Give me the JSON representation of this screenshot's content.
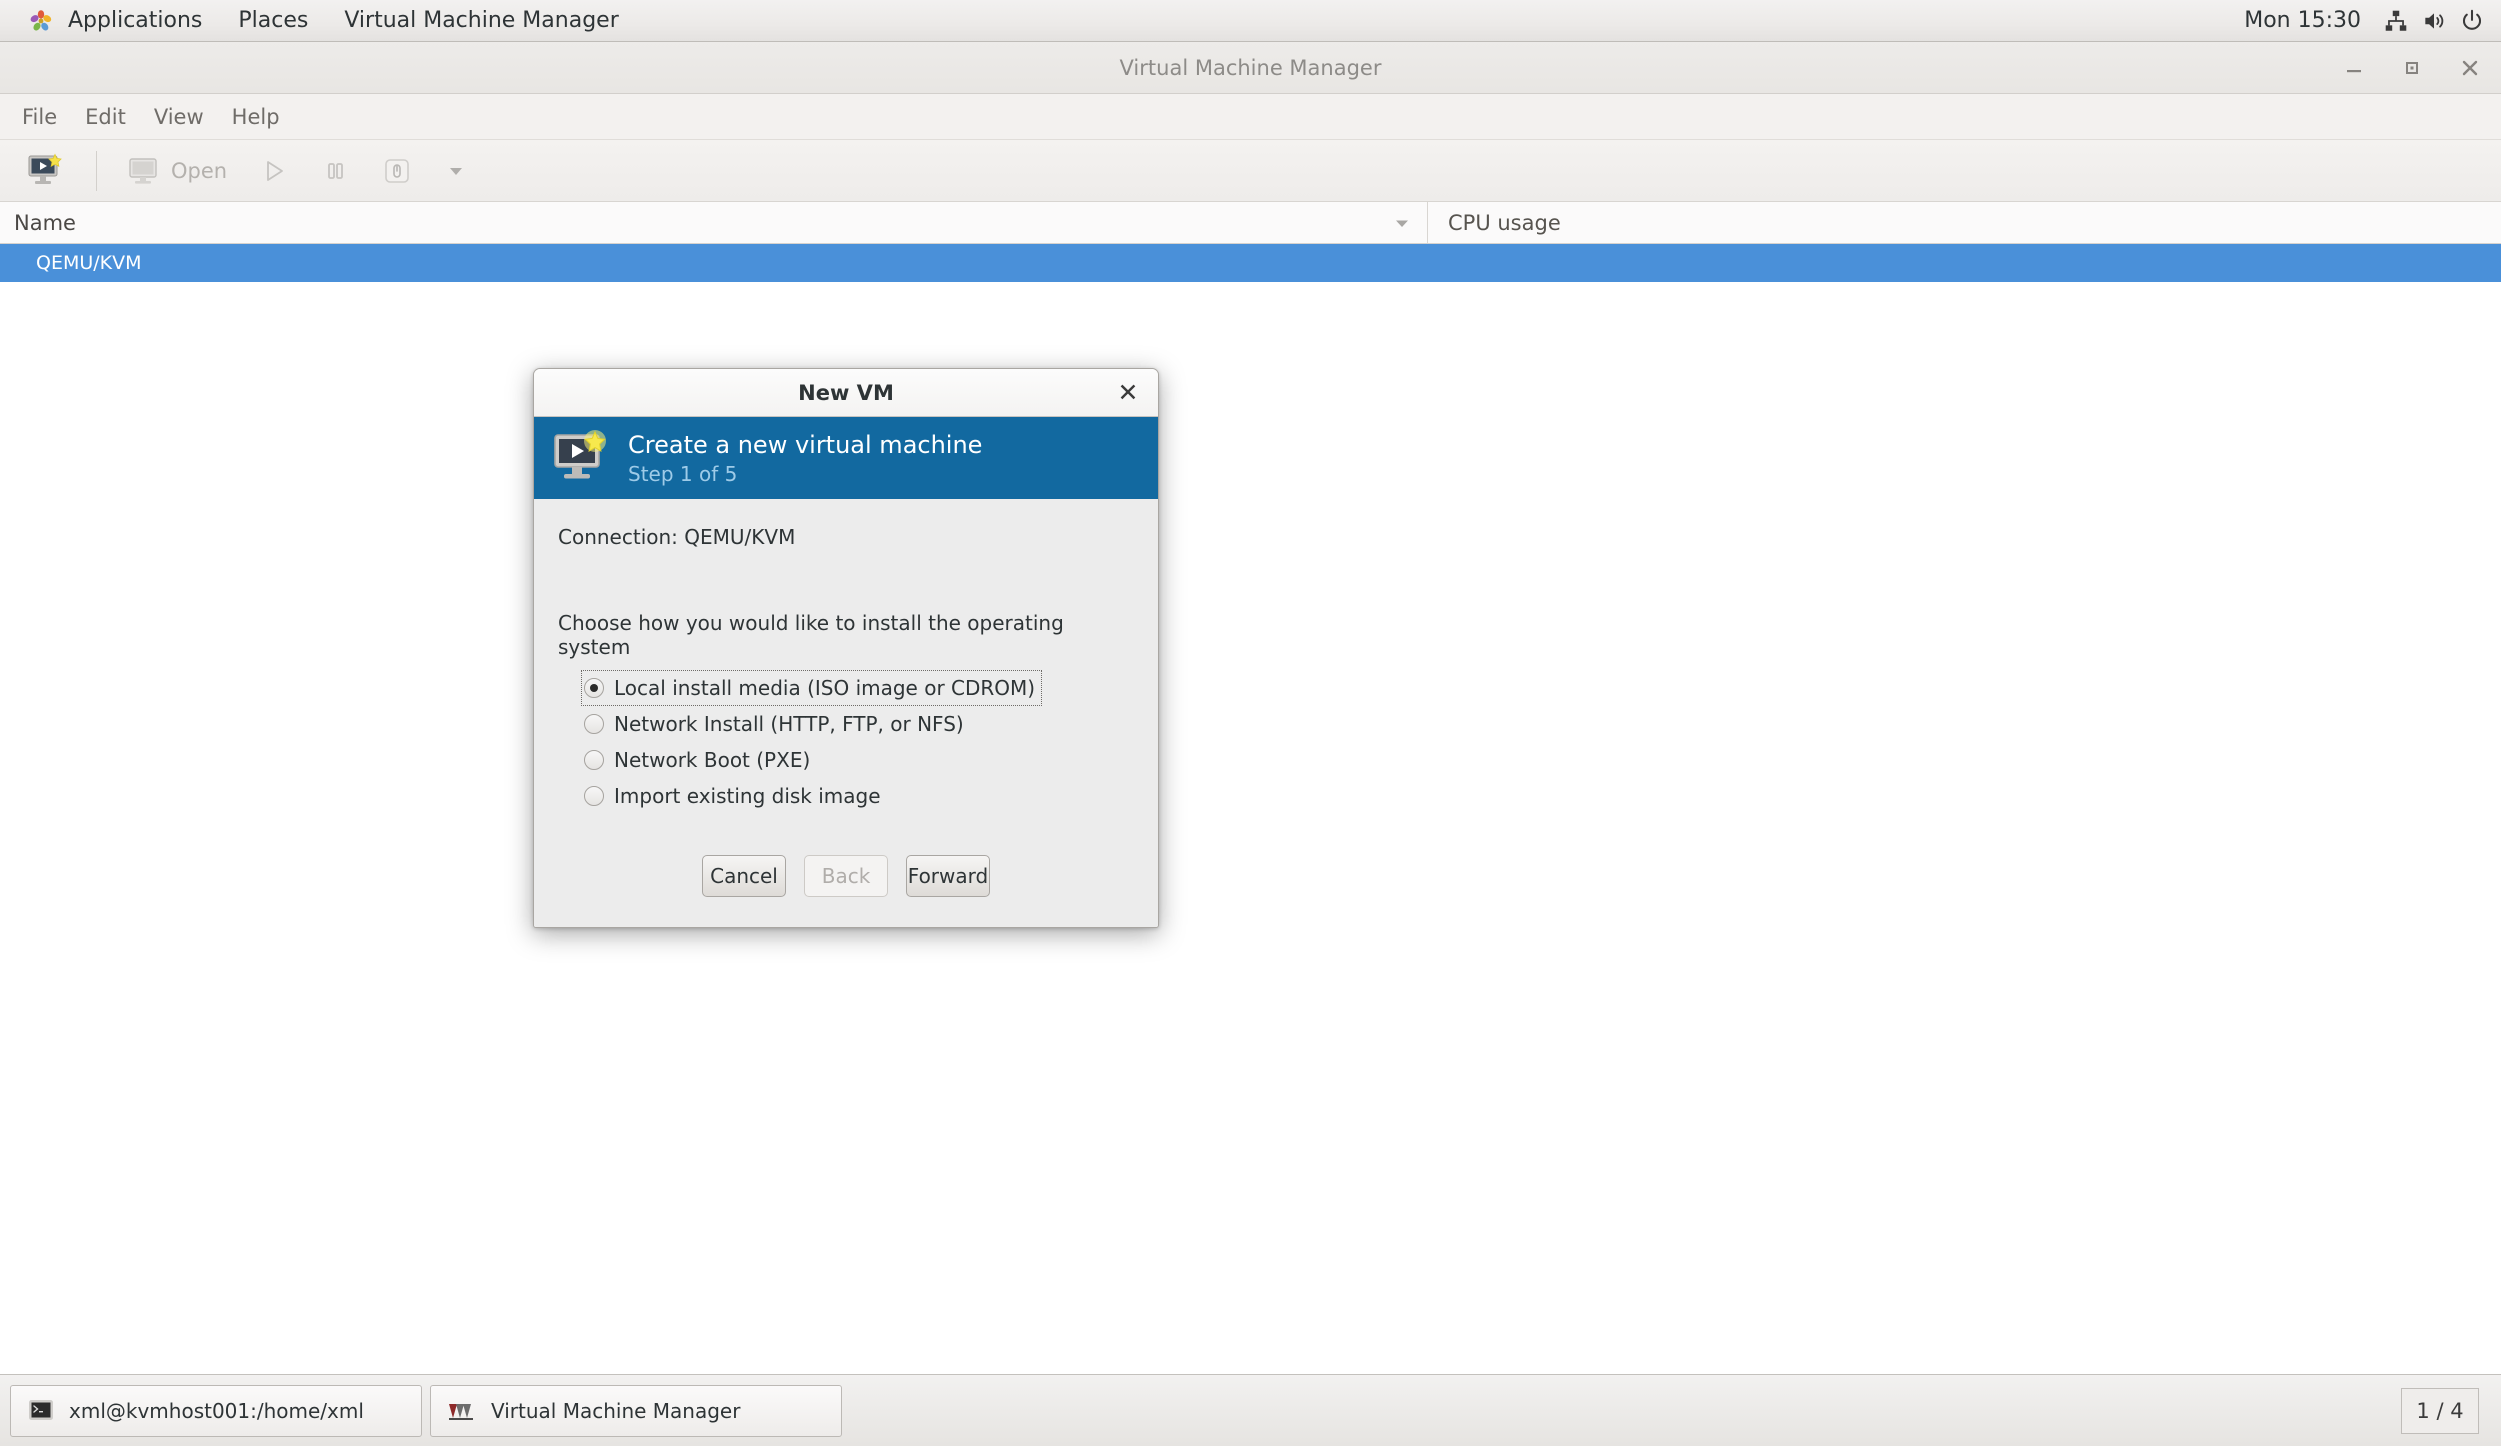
{
  "top_panel": {
    "activities_icon": "gnome-applications-icon",
    "items": [
      {
        "label": "Applications",
        "name": "panel-menu-applications"
      },
      {
        "label": "Places",
        "name": "panel-menu-places"
      },
      {
        "label": "Virtual Machine Manager",
        "name": "panel-menu-app-title"
      }
    ],
    "clock": "Mon 15:30",
    "tray": [
      {
        "icon": "network-icon",
        "name": "tray-network-icon"
      },
      {
        "icon": "volume-icon",
        "name": "tray-volume-icon"
      },
      {
        "icon": "power-icon",
        "name": "tray-power-icon"
      }
    ]
  },
  "window": {
    "title": "Virtual Machine Manager",
    "controls": {
      "minimize": "minimize-icon",
      "maximize": "maximize-icon",
      "close": "close-icon"
    },
    "menubar": [
      "File",
      "Edit",
      "View",
      "Help"
    ],
    "toolbar": {
      "new_vm_icon": "new-vm-icon",
      "open_label": "Open",
      "open_icon": "monitor-icon",
      "run_icon": "play-icon",
      "pause_icon": "pause-icon",
      "shutdown_icon": "shutdown-icon",
      "dropdown_icon": "chevron-down-icon"
    },
    "list": {
      "columns": [
        "Name",
        "CPU usage"
      ],
      "sort_icon": "chevron-down-icon",
      "rows": [
        {
          "name": "QEMU/KVM",
          "cpu": "",
          "selected": true
        }
      ]
    }
  },
  "dialog": {
    "title": "New VM",
    "close_icon": "close-icon",
    "banner": {
      "icon": "new-vm-icon",
      "title": "Create a new virtual machine",
      "step": "Step 1 of 5"
    },
    "connection_label": "Connection:",
    "connection_value": "QEMU/KVM",
    "choose_label": "Choose how you would like to install the operating system",
    "options": [
      {
        "label": "Local install media (ISO image or CDROM)",
        "selected": true,
        "focused": true
      },
      {
        "label": "Network Install (HTTP, FTP, or NFS)",
        "selected": false,
        "focused": false
      },
      {
        "label": "Network Boot (PXE)",
        "selected": false,
        "focused": false
      },
      {
        "label": "Import existing disk image",
        "selected": false,
        "focused": false
      }
    ],
    "buttons": [
      {
        "label": "Cancel",
        "disabled": false,
        "name": "cancel-button"
      },
      {
        "label": "Back",
        "disabled": true,
        "name": "back-button"
      },
      {
        "label": "Forward",
        "disabled": false,
        "name": "forward-button"
      }
    ]
  },
  "taskbar": {
    "tasks": [
      {
        "label": "xml@kvmhost001:/home/xml",
        "icon": "terminal-icon"
      },
      {
        "label": "Virtual Machine Manager",
        "icon": "vmm-icon"
      }
    ],
    "workspace": "1 / 4"
  },
  "colors": {
    "selection_blue": "#4a90d9",
    "banner_blue": "#1269a0",
    "panel_grey": "#eceae8",
    "dialog_grey": "#ececec"
  }
}
